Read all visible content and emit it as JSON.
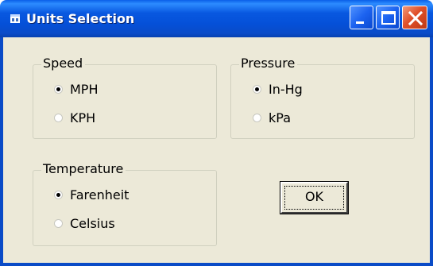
{
  "window": {
    "title": "Units Selection",
    "icon": "app-icon",
    "controls": {
      "minimize": "minimize-icon",
      "maximize": "maximize-icon",
      "close": "close-icon"
    }
  },
  "groups": {
    "speed": {
      "label": "Speed",
      "options": [
        {
          "label": "MPH",
          "checked": true
        },
        {
          "label": "KPH",
          "checked": false
        }
      ]
    },
    "pressure": {
      "label": "Pressure",
      "options": [
        {
          "label": "In-Hg",
          "checked": true
        },
        {
          "label": "kPa",
          "checked": false
        }
      ]
    },
    "temperature": {
      "label": "Temperature",
      "options": [
        {
          "label": "Farenheit",
          "checked": true
        },
        {
          "label": "Celsius",
          "checked": false
        }
      ]
    }
  },
  "ok_button": {
    "label": "OK"
  },
  "colors": {
    "titlebar": "#0a5fe8",
    "dialog_face": "#ece9d8",
    "close_button": "#e0502a"
  }
}
